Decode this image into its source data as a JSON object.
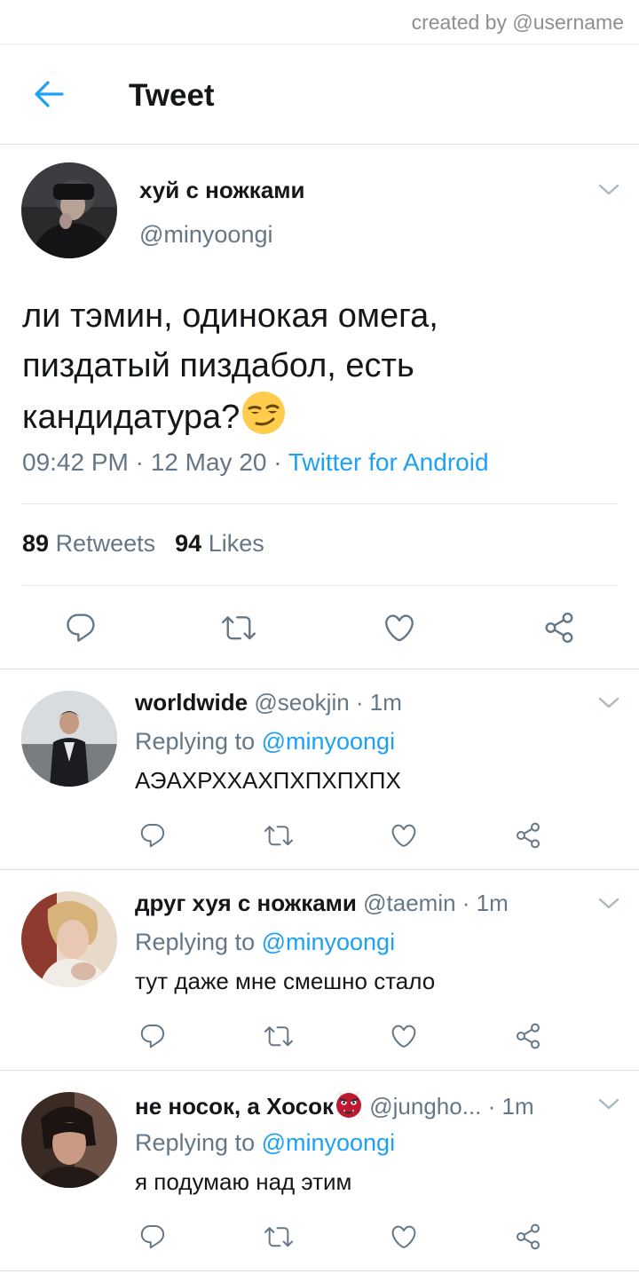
{
  "credit": "created by @username",
  "header": {
    "title": "Tweet"
  },
  "tweet": {
    "display_name": "хуй с ножками",
    "handle": "@minyoongi",
    "text_line1": "ли тэмин, одинокая омега,",
    "text_line2": "пиздатый пиздабол, есть",
    "text_line3": "кандидатура?",
    "emoji": "smirking-face",
    "time_date": "09:42 PM · 12 May 20 · ",
    "source": "Twitter for Android",
    "retweets_count": "89",
    "retweets_label": "Retweets",
    "likes_count": "94",
    "likes_label": "Likes"
  },
  "replies": [
    {
      "display_name": "worldwide",
      "handle": "@seokjin",
      "time": " · 1m",
      "replying_prefix": "Replying to ",
      "mention": "@minyoongi",
      "text": "АЭАХРХХАХПХПХПХПХ"
    },
    {
      "display_name": "друг хуя с ножками",
      "handle": "@taemin",
      "time": " · 1m",
      "replying_prefix": "Replying to ",
      "mention": "@minyoongi",
      "text": "тут даже мне смешно стало"
    },
    {
      "display_name": "не носок, а Хосок",
      "name_emoji": "ogre",
      "handle": "@jungho...",
      "time": " · 1m",
      "replying_prefix": "Replying to ",
      "mention": "@minyoongi",
      "text": "я подумаю над этим"
    }
  ],
  "colors": {
    "accent": "#1da1f2",
    "secondary_text": "#657786",
    "icon_gray": "#657786",
    "divider": "#e1e8ed"
  },
  "icons": {
    "back": "arrow-left-icon",
    "menu": "chevron-down-icon",
    "reply": "reply-icon",
    "retweet": "retweet-icon",
    "like": "heart-icon",
    "share": "share-icon"
  }
}
